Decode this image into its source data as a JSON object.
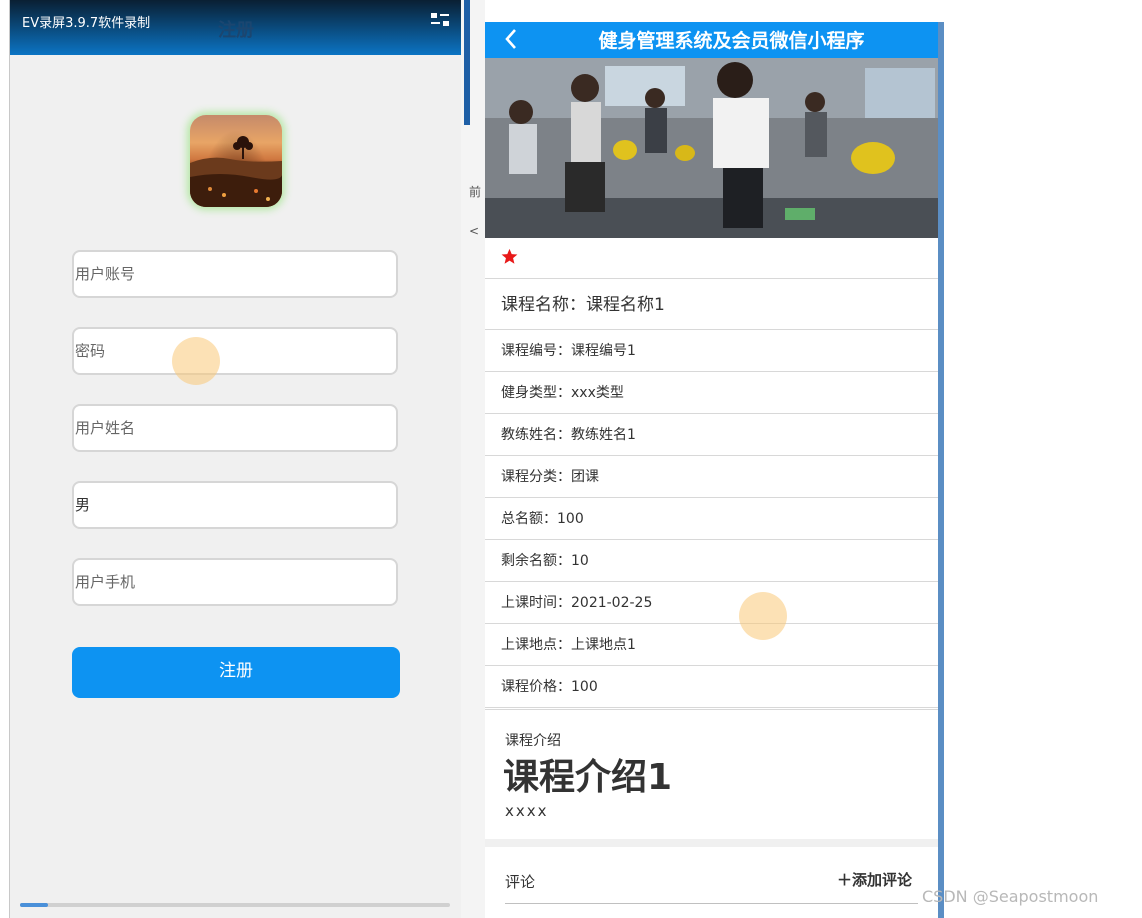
{
  "left_screen": {
    "recorder_label": "EV录屏3.9.7软件录制",
    "title": "注册",
    "fields": [
      {
        "placeholder": "用户账号"
      },
      {
        "placeholder": "密码"
      },
      {
        "placeholder": "用户姓名"
      },
      {
        "value": "男"
      },
      {
        "placeholder": "用户手机"
      }
    ],
    "register_label": "注册"
  },
  "right_screen": {
    "title": "健身管理系统及会员微信小程序",
    "course_name": "课程名称：课程名称1",
    "details": [
      "课程编号：课程编号1",
      "健身类型：xxx类型",
      "教练姓名：教练姓名1",
      "课程分类：团课",
      "总名额：100",
      "剩余名额：10",
      "上课时间：2021-02-25",
      "上课地点：上课地点1",
      "课程价格：100"
    ],
    "intro_label": "课程介绍",
    "intro_heading": "课程介绍1",
    "intro_body": "xxxx",
    "comment_label": "评论",
    "add_comment_label": "＋添加评论"
  },
  "middle_strip_glyphs": [
    "前",
    "<"
  ],
  "watermark": "CSDN @Seapostmoon",
  "colors": {
    "accent": "#0d93f2",
    "favorite_star": "#e81919",
    "touch_indicator": "#f9c878"
  }
}
